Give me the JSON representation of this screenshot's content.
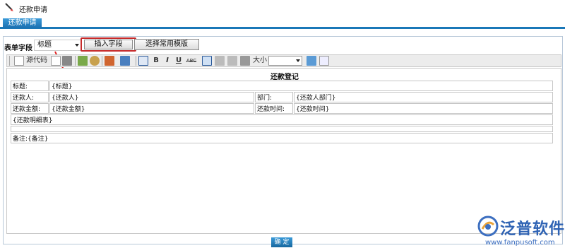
{
  "window": {
    "title": "还款申请"
  },
  "tabs": [
    {
      "label": "还款申请",
      "active": true
    }
  ],
  "form_field": {
    "label": "表单字段",
    "selected": "标题",
    "insert_button": "插入字段",
    "template_button": "选择常用模版"
  },
  "toolbar": {
    "source_label": "源代码",
    "bold": "B",
    "italic": "I",
    "underline": "U",
    "strike": "ABC",
    "size_label": "大小"
  },
  "document": {
    "title": "还款登记",
    "rows": [
      {
        "label": "标题:",
        "value": "{标题}"
      },
      {
        "label": "还款人:",
        "value": "{还款人}",
        "label2": "部门:",
        "value2": "{还款人部门}"
      },
      {
        "label": "还款金额:",
        "value": "{还款金额}",
        "label2": "还款时间:",
        "value2": "{还款时间}"
      }
    ],
    "detail": "{还款明细表}",
    "remark": "备注:{备注}"
  },
  "confirm_button": "确 定",
  "watermark": {
    "brand": "泛普软件",
    "url": "www.fanpusoft.com"
  },
  "colors": {
    "accent": "#1a78b8",
    "highlight_border": "#c62a2a",
    "brand": "#2f63b4"
  }
}
